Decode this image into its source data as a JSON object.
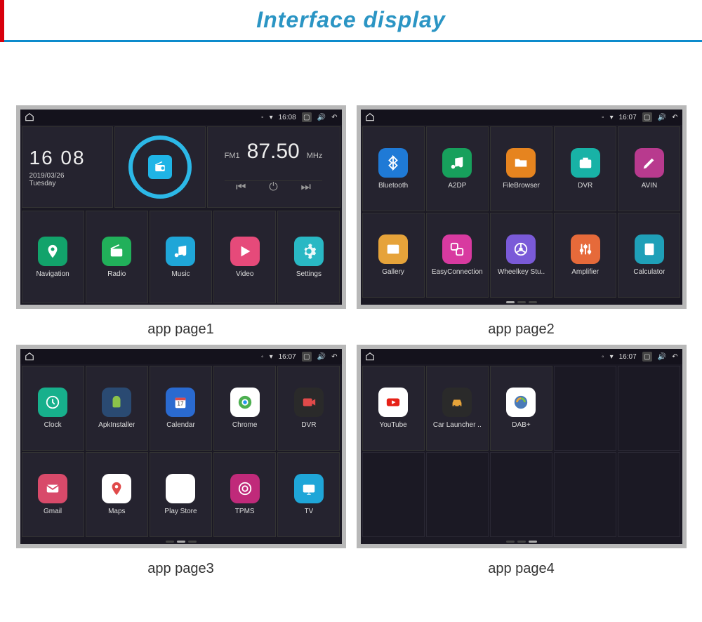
{
  "header": {
    "title": "Interface display"
  },
  "captions": [
    "app page1",
    "app page2",
    "app page3",
    "app page4"
  ],
  "statusbar": {
    "times": [
      "16:08",
      "16:07",
      "16:07",
      "16:07"
    ]
  },
  "panel1": {
    "clock": {
      "time": "16 08",
      "date": "2019/03/26",
      "day": "Tuesday"
    },
    "radio": {
      "band": "FM1",
      "freq": "87.50",
      "unit": "MHz"
    },
    "apps": [
      {
        "label": "Navigation",
        "color": "#12a36b",
        "icon": "pin"
      },
      {
        "label": "Radio",
        "color": "#21b05a",
        "icon": "radio"
      },
      {
        "label": "Music",
        "color": "#1fa6d8",
        "icon": "music"
      },
      {
        "label": "Video",
        "color": "#e64a7a",
        "icon": "play"
      },
      {
        "label": "Settings",
        "color": "#29b8c4",
        "icon": "gear"
      }
    ]
  },
  "panel2": {
    "apps": [
      {
        "label": "Bluetooth",
        "color": "#1f7ad6",
        "icon": "bt"
      },
      {
        "label": "A2DP",
        "color": "#17a05c",
        "icon": "music"
      },
      {
        "label": "FileBrowser",
        "color": "#e6841f",
        "icon": "folder"
      },
      {
        "label": "DVR",
        "color": "#18b2a6",
        "icon": "camera"
      },
      {
        "label": "AVIN",
        "color": "#b83a8e",
        "icon": "pen"
      },
      {
        "label": "Gallery",
        "color": "#e6a33a",
        "icon": "image"
      },
      {
        "label": "EasyConnection",
        "color": "#d83aa0",
        "icon": "link"
      },
      {
        "label": "Wheelkey Stu..",
        "color": "#7a5ad8",
        "icon": "wheel"
      },
      {
        "label": "Amplifier",
        "color": "#e66a3a",
        "icon": "sliders"
      },
      {
        "label": "Calculator",
        "color": "#1fa0b8",
        "icon": "calc"
      }
    ]
  },
  "panel3": {
    "apps": [
      {
        "label": "Clock",
        "color": "#17b08c",
        "icon": "clock"
      },
      {
        "label": "ApkInstaller",
        "color": "#2a4a72",
        "icon": "android"
      },
      {
        "label": "Calendar",
        "color": "#2a6ad0",
        "icon": "cal"
      },
      {
        "label": "Chrome",
        "color": "#ffffff",
        "icon": "chrome"
      },
      {
        "label": "DVR",
        "color": "#2a2a2a",
        "icon": "rec"
      },
      {
        "label": "Gmail",
        "color": "#d84a6a",
        "icon": "mail"
      },
      {
        "label": "Maps",
        "color": "#ffffff",
        "icon": "maps"
      },
      {
        "label": "Play Store",
        "color": "#ffffff",
        "icon": "play"
      },
      {
        "label": "TPMS",
        "color": "#c02a7a",
        "icon": "tire"
      },
      {
        "label": "TV",
        "color": "#1fa6d8",
        "icon": "tv"
      }
    ]
  },
  "panel4": {
    "apps": [
      {
        "label": "YouTube",
        "color": "#ffffff",
        "icon": "yt"
      },
      {
        "label": "Car Launcher ..",
        "color": "#2a2a2a",
        "icon": "car"
      },
      {
        "label": "DAB+",
        "color": "#ffffff",
        "icon": "dab"
      }
    ]
  }
}
